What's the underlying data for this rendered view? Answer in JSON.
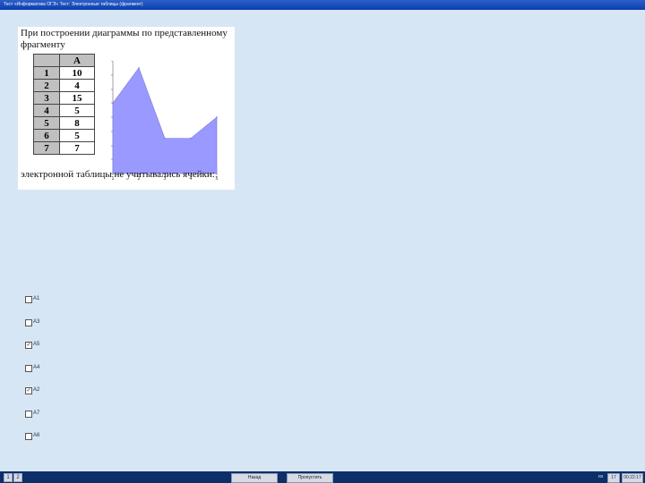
{
  "window": {
    "title": "Тест «Информатика ОГЭ» Тест: Электронные таблицы (фрагмент)"
  },
  "question": {
    "text": "При построении диаграммы по представленному фрагменту",
    "tail": "электронной таблицы не учитывались ячейки:",
    "sheet": {
      "column_header": "A",
      "rows": [
        {
          "n": "1",
          "v": "10"
        },
        {
          "n": "2",
          "v": "4"
        },
        {
          "n": "3",
          "v": "15"
        },
        {
          "n": "4",
          "v": "5"
        },
        {
          "n": "5",
          "v": "8"
        },
        {
          "n": "6",
          "v": "5"
        },
        {
          "n": "7",
          "v": "7"
        }
      ]
    }
  },
  "chart_data": {
    "type": "area",
    "x": [
      1,
      2,
      3,
      4,
      5
    ],
    "values": [
      10,
      15,
      5,
      5,
      8
    ],
    "ylim": [
      0,
      16
    ],
    "color": "#9999ff",
    "grid": false
  },
  "options": [
    {
      "label": "A1",
      "checked": false
    },
    {
      "label": "A3",
      "checked": false
    },
    {
      "label": "A5",
      "checked": true
    },
    {
      "label": "A4",
      "checked": false
    },
    {
      "label": "A2",
      "checked": true
    },
    {
      "label": "A7",
      "checked": false
    },
    {
      "label": "A6",
      "checked": false
    }
  ],
  "taskbar": {
    "btn1": "1",
    "btn2": "2",
    "back_label": "Назад",
    "next_label": "Пропустить",
    "counter_label": "из",
    "page_number": "17",
    "timer": "00:22:17"
  }
}
